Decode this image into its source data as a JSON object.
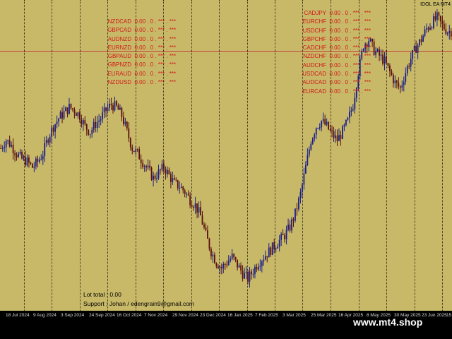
{
  "ea_label": "IDOL EA MT4",
  "pairs_left": [
    {
      "symbol": "NZDCAD",
      "values": "0.00 . 0 . *** . ***"
    },
    {
      "symbol": "GBPCAD",
      "values": "0.00 . 0 . *** . ***"
    },
    {
      "symbol": "AUDNZD",
      "values": "0.00 . 0 . *** . ***"
    },
    {
      "symbol": "EURNZD",
      "values": "0.00 . 0 . *** . ***"
    },
    {
      "symbol": "GBPAUD",
      "values": "0.00 . 0 . *** . ***"
    },
    {
      "symbol": "GBPNZD",
      "values": "0.00 . 0 . *** . ***"
    },
    {
      "symbol": "EURAUD",
      "values": "0.00 . 0 . *** . ***"
    },
    {
      "symbol": "NZDUSD",
      "values": "0.00 . 0 . *** . ***"
    }
  ],
  "pairs_right": [
    {
      "symbol": "CADJPY",
      "values": "0.00 . 0 . *** . ***"
    },
    {
      "symbol": "EURCHF",
      "values": "0.00 . 0 . *** . ***"
    },
    {
      "symbol": "USDCHF",
      "values": "0.00 . 0 . *** . ***"
    },
    {
      "symbol": "GBPCHF",
      "values": "0.00 . 0 . *** . ***"
    },
    {
      "symbol": "CADCHF",
      "values": "0.00 . 0 . *** . ***"
    },
    {
      "symbol": "NZDCHF",
      "values": "0.00 . 0 . *** . ***"
    },
    {
      "symbol": "AUDCHF",
      "values": "0.00 . 0 . *** . ***"
    },
    {
      "symbol": "USDCAD",
      "values": "0.00 . 0 . *** . ***"
    },
    {
      "symbol": "AUDCAD",
      "values": "0.00 . 0 . *** . ***"
    },
    {
      "symbol": "EURCAD",
      "values": "0.00 . 0 . *** . ***"
    }
  ],
  "lot_total": "Lot total :  0.00",
  "support": "Support : Johan / edengrain9@gmail.com",
  "time_axis": [
    "18 Jul 2024",
    "9 Aug 2024",
    "3 Sep 2024",
    "24 Sep 2024",
    "16 Oct 2024",
    "7 Nov 2024",
    "29 Nov 2024",
    "23 Dec 2024",
    "16 Jan 2025",
    "7 Feb 2025",
    "3 Mar 2025",
    "25 Mar 2025",
    "16 Apr 2025",
    "8 May 2025",
    "30 May 2025",
    "23 Jun 2025",
    "15"
  ],
  "watermark": "www.mt4.shop",
  "colors": {
    "background": "#c8b968",
    "bull": "#1a1f8c",
    "bear": "#5a0f10",
    "text_red": "#d11818",
    "hline": "#c4423d"
  },
  "price_series": [
    52,
    55,
    53,
    50,
    48,
    47,
    45,
    47,
    50,
    56,
    60,
    63,
    65,
    67,
    66,
    64,
    60,
    58,
    61,
    63,
    66,
    68,
    67,
    64,
    58,
    52,
    50,
    47,
    44,
    41,
    43,
    45,
    42,
    39,
    38,
    36,
    33,
    31,
    27,
    20,
    14,
    10,
    8,
    10,
    12,
    9,
    6,
    4,
    7,
    10,
    12,
    14,
    16,
    18,
    20,
    23,
    28,
    35,
    45,
    55,
    60,
    62,
    60,
    57,
    55,
    58,
    62,
    68,
    80,
    90,
    92,
    88,
    86,
    84,
    80,
    76,
    74,
    80,
    85,
    89,
    92,
    96,
    98,
    100,
    97,
    95
  ]
}
